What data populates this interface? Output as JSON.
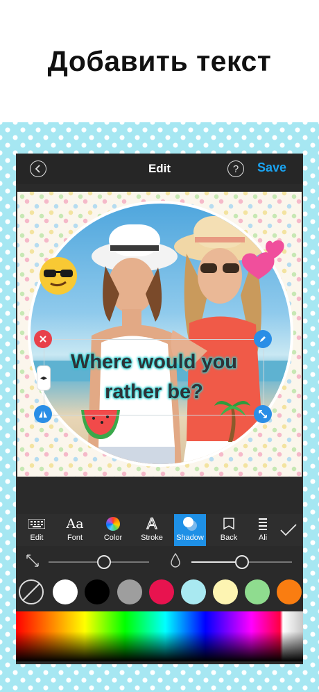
{
  "headline": "Добавить текст",
  "topbar": {
    "title": "Edit",
    "save_label": "Save",
    "help_label": "?"
  },
  "canvas": {
    "text_lines": [
      "Where would you",
      "rather be?"
    ],
    "text_colors": {
      "fill": "#2f3237",
      "shadow": "#28d4d4"
    },
    "stickers": [
      "sunglasses-emoji",
      "heart-emoji",
      "watermelon-emoji",
      "palm-tree-emoji"
    ]
  },
  "toolbar": {
    "items": [
      {
        "label": "Edit",
        "icon": "keyboard-icon"
      },
      {
        "label": "Font",
        "icon": "font-aa-icon"
      },
      {
        "label": "Color",
        "icon": "color-wheel-icon"
      },
      {
        "label": "Stroke",
        "icon": "stroke-a-icon"
      },
      {
        "label": "Shadow",
        "icon": "shadow-icon"
      },
      {
        "label": "Back",
        "icon": "back-layer-icon"
      },
      {
        "label": "Ali",
        "icon": "align-icon"
      }
    ],
    "active": "Shadow",
    "confirm_icon": "checkmark-icon"
  },
  "sliders": {
    "offset_value": 0.55,
    "opacity_value": 0.5
  },
  "swatches": [
    "none",
    "#ffffff",
    "#000000",
    "#9e9e9e",
    "#e8134f",
    "#a9e9f1",
    "#fdf4b2",
    "#8fdc8f",
    "#fa7d11"
  ]
}
